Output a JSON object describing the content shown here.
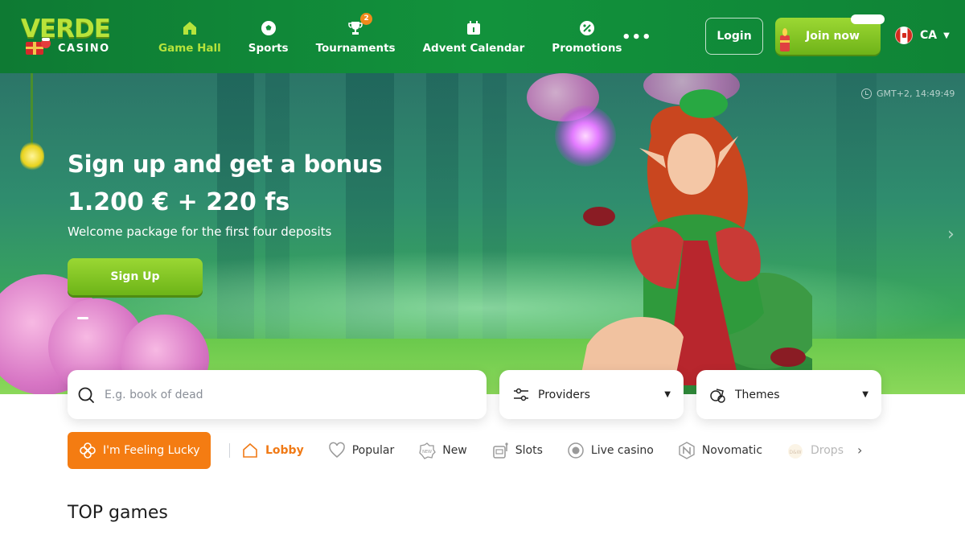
{
  "header": {
    "logo": {
      "brand": "VERDE",
      "sub": "CASINO"
    },
    "nav": [
      {
        "label": "Game Hall",
        "icon": "home-icon",
        "active": true
      },
      {
        "label": "Sports",
        "icon": "soccer-ball-icon"
      },
      {
        "label": "Tournaments",
        "icon": "trophy-icon",
        "badge": "2"
      },
      {
        "label": "Advent Calendar",
        "icon": "calendar-icon"
      },
      {
        "label": "Promotions",
        "icon": "percent-badge-icon"
      }
    ],
    "more_label": "•••",
    "login_label": "Login",
    "join_label": "Join now",
    "lang": {
      "code": "CA",
      "flag": "canada-flag-icon"
    }
  },
  "hero": {
    "clock": "GMT+2, 14:49:49",
    "title": "Sign up and get a bonus",
    "amount": "1.200 € + 220 fs",
    "subtitle": "Welcome package for the first four deposits",
    "cta": "Sign Up"
  },
  "search": {
    "placeholder": "E.g. book of dead",
    "providers_label": "Providers",
    "themes_label": "Themes"
  },
  "categories": {
    "lucky_label": "I'm Feeling Lucky",
    "items": [
      {
        "label": "Lobby",
        "icon": "home-icon",
        "active": true
      },
      {
        "label": "Popular",
        "icon": "heart-icon"
      },
      {
        "label": "New",
        "icon": "new-badge-icon"
      },
      {
        "label": "Slots",
        "icon": "slot-machine-icon"
      },
      {
        "label": "Live casino",
        "icon": "live-dot-icon"
      },
      {
        "label": "Novomatic",
        "icon": "novomatic-logo-icon"
      },
      {
        "label": "Drops",
        "icon": "drops-wins-icon"
      }
    ]
  },
  "section": {
    "title": "TOP games"
  },
  "colors": {
    "header_green": "#12923c",
    "accent_lime": "#b6e33c",
    "button_green": "#7fc425",
    "lucky_orange": "#f47c12"
  }
}
